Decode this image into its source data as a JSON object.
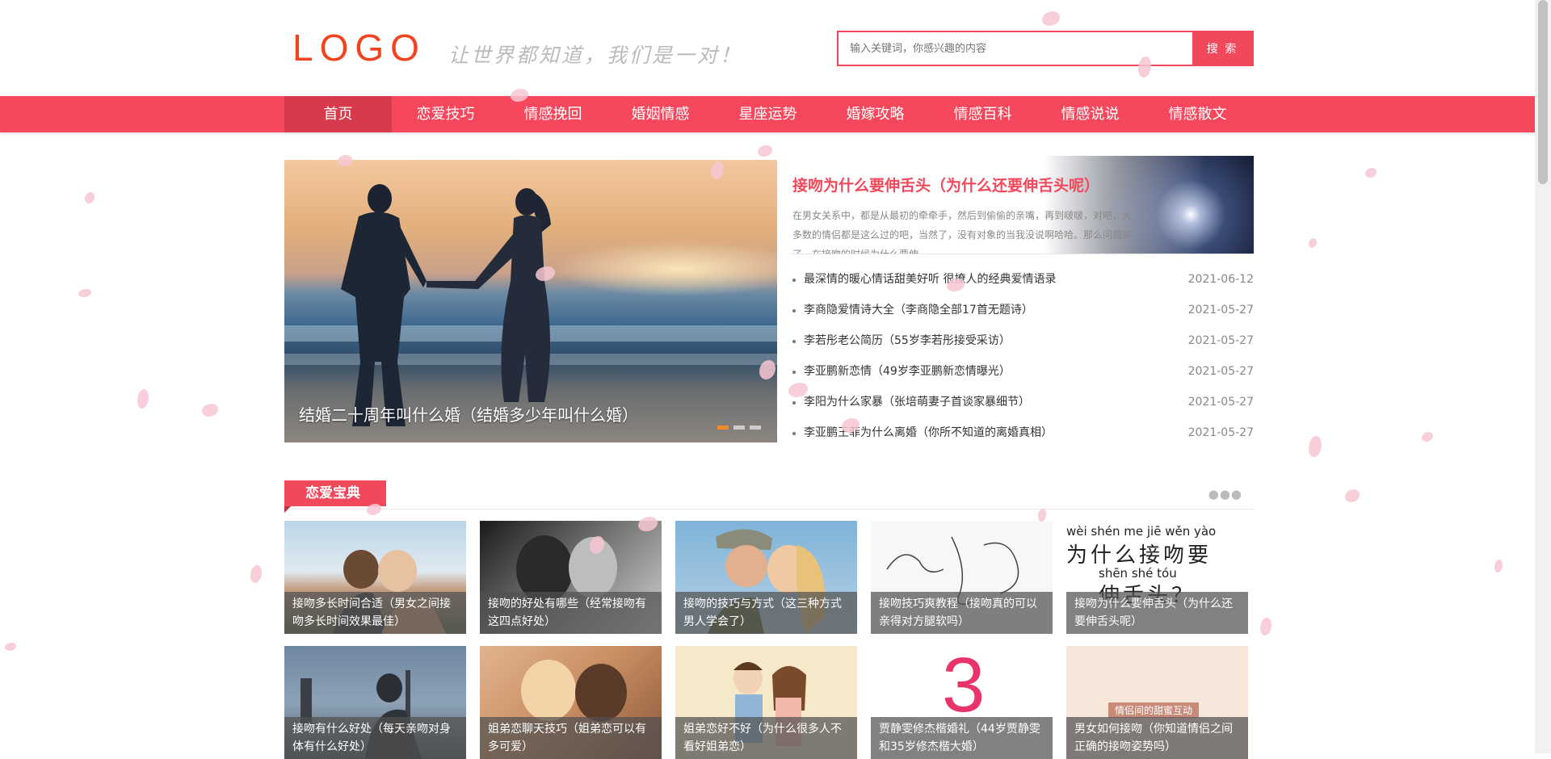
{
  "header": {
    "logo": "LOGO",
    "slogan": "让世界都知道，我们是一对！",
    "search_placeholder": "输入关键词，你感兴趣的内容",
    "search_button": "搜 索"
  },
  "nav": {
    "items": [
      "首页",
      "恋爱技巧",
      "情感挽回",
      "婚姻情感",
      "星座运势",
      "婚嫁攻略",
      "情感百科",
      "情感说说",
      "情感散文"
    ],
    "active_index": 0
  },
  "hero": {
    "caption": "结婚二十周年叫什么婚（结婚多少年叫什么婚）"
  },
  "featured": {
    "title": "接吻为什么要伸舌头（为什么还要伸舌头呢）",
    "summary": "在男女关系中，都是从最初的牵牵手，然后到偷偷的亲嘴，再到啵啵，对吧，大多数的情侣都是这么过的吧，当然了，没有对象的当我没说啊哈哈。那么问题来了，在接吻的时候为什么要伸"
  },
  "news_list": [
    {
      "title": "最深情的暖心情话甜美好听 很撩人的经典爱情语录",
      "date": "2021-06-12"
    },
    {
      "title": "李商隐爱情诗大全（李商隐全部17首无题诗）",
      "date": "2021-05-27"
    },
    {
      "title": "李若彤老公简历（55岁李若彤接受采访）",
      "date": "2021-05-27"
    },
    {
      "title": "李亚鹏新恋情（49岁李亚鹏新恋情曝光）",
      "date": "2021-05-27"
    },
    {
      "title": "李阳为什么家暴（张培萌妻子首谈家暴细节）",
      "date": "2021-05-27"
    },
    {
      "title": "李亚鹏王菲为什么离婚（你所不知道的离婚真相）",
      "date": "2021-05-27"
    }
  ],
  "section": {
    "title": "恋爱宝典",
    "more": "●●●"
  },
  "cards": [
    {
      "caption": "接吻多长时间合适（男女之间接吻多长时间效果最佳）"
    },
    {
      "caption": "接吻的好处有哪些（经常接吻有这四点好处）"
    },
    {
      "caption": "接吻的技巧与方式（这三种方式男人学会了）"
    },
    {
      "caption": "接吻技巧爽教程（接吻真的可以亲得对方腿软吗）"
    },
    {
      "caption": "接吻为什么要伸舌头（为什么还要伸舌头呢）"
    },
    {
      "caption": "接吻有什么好处（每天亲吻对身体有什么好处）"
    },
    {
      "caption": "姐弟恋聊天技巧（姐弟恋可以有多可爱）"
    },
    {
      "caption": "姐弟恋好不好（为什么很多人不看好姐弟恋）"
    },
    {
      "caption": "贾静雯修杰楷婚礼（44岁贾静雯和35岁修杰楷大婚）"
    },
    {
      "caption": "男女如何接吻（你知道情侣之间正确的接吻姿势吗）"
    }
  ],
  "card4_image_text": {
    "pinyin": "wèi shén me jiē wěn yào",
    "hanzi": "为什么接吻要",
    "pinyin2": "shēn shé tóu",
    "hanzi2": "伸舌头？"
  },
  "card9_image_text": "3",
  "card10_image_text": "情侣间的甜蜜互动",
  "colors": {
    "accent": "#f7475c",
    "nav_active": "#d63a4b",
    "logo": "#f0431e"
  }
}
